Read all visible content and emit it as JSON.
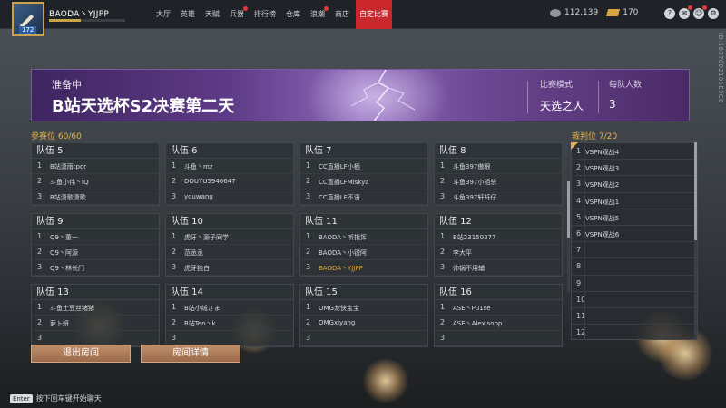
{
  "player": {
    "name": "BAODA丶YJJPP",
    "level": "172",
    "exp_fraction": 0.42
  },
  "nav": {
    "tabs": [
      "大厅",
      "英雄",
      "天赋",
      "兵器",
      "排行榜",
      "仓库",
      "浪潮",
      "商店",
      "自定比赛"
    ],
    "active_tab": "自定比赛"
  },
  "currency": {
    "silver": "112,139",
    "gold": "170"
  },
  "top_icons": [
    "help-icon",
    "mail-icon",
    "friends-icon",
    "settings-icon"
  ],
  "room": {
    "status": "准备中",
    "title": "B站天选杯S2决赛第二天",
    "mode_label": "比赛模式",
    "mode_value": "天选之人",
    "team_size_label": "每队人数",
    "team_size_value": "3",
    "room_id": "ID:1037002101E9C8"
  },
  "slots_label": "参赛位 60/60",
  "referee_label": "裁判位 7/20",
  "teams": [
    {
      "name": "队伍 5",
      "members": [
        "B站潇雨tpor",
        "斗鱼小伟丶IQ",
        "B站潇歌潇歌"
      ]
    },
    {
      "name": "队伍 6",
      "members": [
        "斗鱼丶mz",
        "DOUYU5946647",
        "youwang"
      ]
    },
    {
      "name": "队伍 7",
      "members": [
        "CC直播LF小栖",
        "CC直播LFMiskya",
        "CC直播LF不语"
      ]
    },
    {
      "name": "队伍 8",
      "members": [
        "斗鱼397傲眼",
        "斗鱼397小祖杀",
        "斗鱼397轩轩仔"
      ]
    },
    {
      "name": "队伍 9",
      "members": [
        "Q9丶董一",
        "Q9丶阿源",
        "Q9丶林长门"
      ]
    },
    {
      "name": "队伍 10",
      "members": [
        "虎牙丶源子同学",
        "范丞丞",
        "虎牙独白"
      ]
    },
    {
      "name": "队伍 11",
      "members": [
        "BAODA丶听指挥",
        "BAODA丶小锐阿",
        "BAODA丶YJJPP"
      ]
    },
    {
      "name": "队伍 12",
      "members": [
        "B站23150377",
        "李大平",
        "帅锅不用辅"
      ]
    },
    {
      "name": "队伍 13",
      "members": [
        "斗鱼土豆丝猪猪",
        "萝卜妍",
        ""
      ]
    },
    {
      "name": "队伍 14",
      "members": [
        "B站小绒さま",
        "B站Ten丶k",
        ""
      ]
    },
    {
      "name": "队伍 15",
      "members": [
        "OMG龙侠宝宝",
        "OMGxiyang",
        ""
      ]
    },
    {
      "name": "队伍 16",
      "members": [
        "ASE丶Pu1se",
        "ASE丶Alexisoop",
        ""
      ]
    }
  ],
  "self_member": "BAODA丶YJJPP",
  "referees": [
    "VSPN观战4",
    "VSPN观战3",
    "VSPN观战2",
    "VSPN观战1",
    "VSPN观战5",
    "VSPN观战6",
    "",
    "",
    "",
    "",
    "",
    ""
  ],
  "buttons": {
    "leave": "退出房间",
    "details": "房间详情"
  },
  "chat_hint": {
    "key": "Enter",
    "text": "按下回车键开始聊天"
  }
}
